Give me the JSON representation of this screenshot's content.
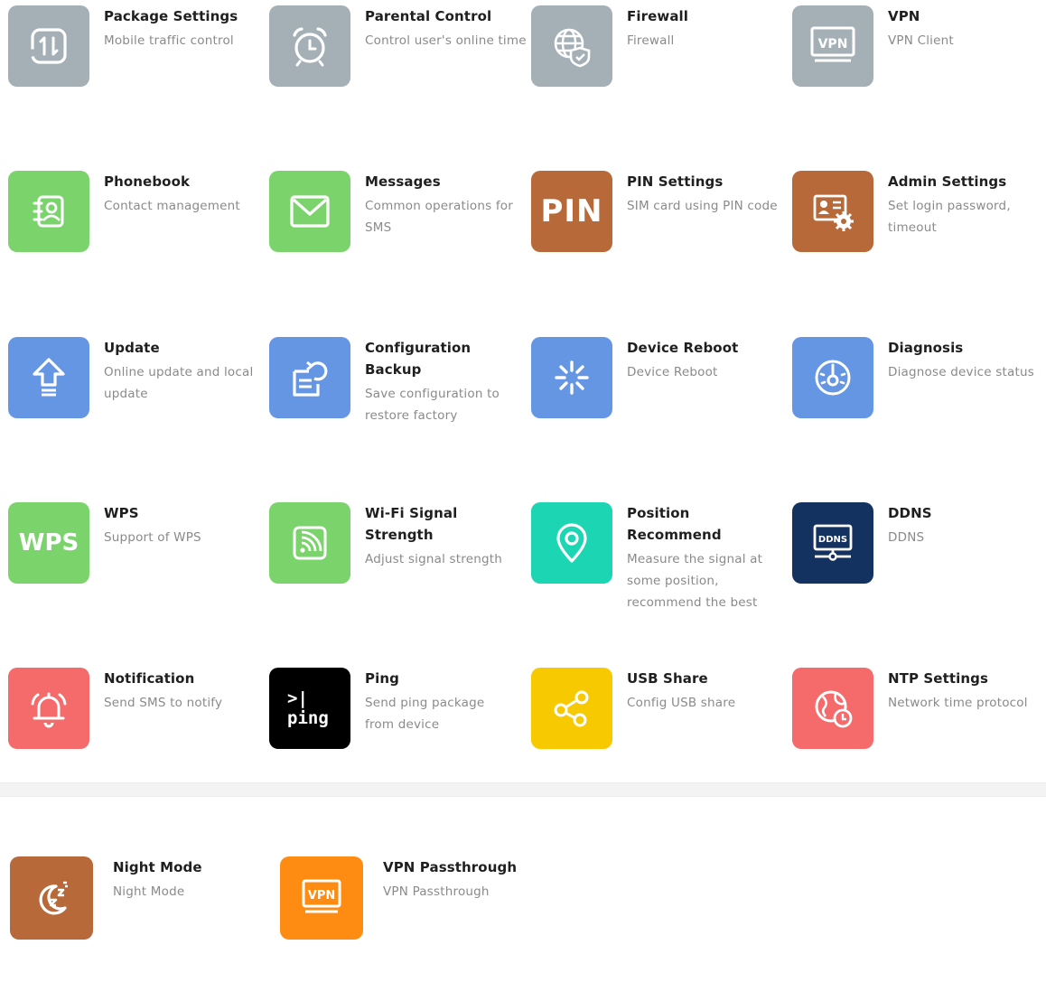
{
  "colors": {
    "gray": "#a4b0b6",
    "green": "#7ad36b",
    "brown": "#b8693a",
    "blue": "#6596e4",
    "teal": "#1bd5b3",
    "navy": "#13325f",
    "red": "#f56b6b",
    "black": "#000000",
    "yellow": "#f7c900",
    "orange": "#ff8c12"
  },
  "tiles": [
    {
      "title": "Package Settings",
      "desc": "Mobile traffic control",
      "icon": "traffic-icon"
    },
    {
      "title": "Parental Control",
      "desc": "Control user's online time",
      "icon": "alarm-clock-icon"
    },
    {
      "title": "Firewall",
      "desc": "Firewall",
      "icon": "globe-shield-icon"
    },
    {
      "title": "VPN",
      "desc": "VPN Client",
      "icon": "vpn-monitor-icon",
      "icon_text": "VPN"
    },
    {
      "title": "Phonebook",
      "desc": "Contact management",
      "icon": "contact-book-icon"
    },
    {
      "title": "Messages",
      "desc": "Common operations for SMS",
      "icon": "envelope-icon"
    },
    {
      "title": "PIN Settings",
      "desc": "SIM card using PIN code",
      "icon": "pin-text-icon",
      "icon_text": "PIN"
    },
    {
      "title": "Admin Settings",
      "desc": "Set login password, timeout",
      "icon": "admin-card-gear-icon"
    },
    {
      "title": "Update",
      "desc": "Online update and local update",
      "icon": "upload-arrow-icon"
    },
    {
      "title": "Configuration Backup",
      "desc": "Save configuration to restore factory",
      "icon": "backup-file-icon"
    },
    {
      "title": "Device Reboot",
      "desc": "Device Reboot",
      "icon": "spinner-icon"
    },
    {
      "title": "Diagnosis",
      "desc": "Diagnose device status",
      "icon": "gauge-icon"
    },
    {
      "title": "WPS",
      "desc": "Support of WPS",
      "icon": "wps-text-icon",
      "icon_text": "WPS"
    },
    {
      "title": "Wi-Fi Signal Strength",
      "desc": "Adjust signal strength",
      "icon": "signal-icon"
    },
    {
      "title": "Position Recommend",
      "desc": "Measure the signal at some position, recommend the best",
      "icon": "location-pin-icon"
    },
    {
      "title": "DDNS",
      "desc": "DDNS",
      "icon": "ddns-monitor-icon",
      "icon_text": "DDNS"
    },
    {
      "title": "Notification",
      "desc": "Send SMS to notify",
      "icon": "bell-icon"
    },
    {
      "title": "Ping",
      "desc": "Send ping package from device",
      "icon": "terminal-icon",
      "icon_text_1": ">|",
      "icon_text_2": "ping"
    },
    {
      "title": "USB Share",
      "desc": "Config USB share",
      "icon": "share-icon"
    },
    {
      "title": "NTP Settings",
      "desc": "Network time protocol",
      "icon": "globe-clock-icon"
    }
  ],
  "bottom_tiles": [
    {
      "title": "Night Mode",
      "desc": "Night Mode",
      "icon": "moon-icon"
    },
    {
      "title": "VPN Passthrough",
      "desc": "VPN Passthrough",
      "icon": "vpn-monitor-icon",
      "icon_text": "VPN"
    }
  ]
}
